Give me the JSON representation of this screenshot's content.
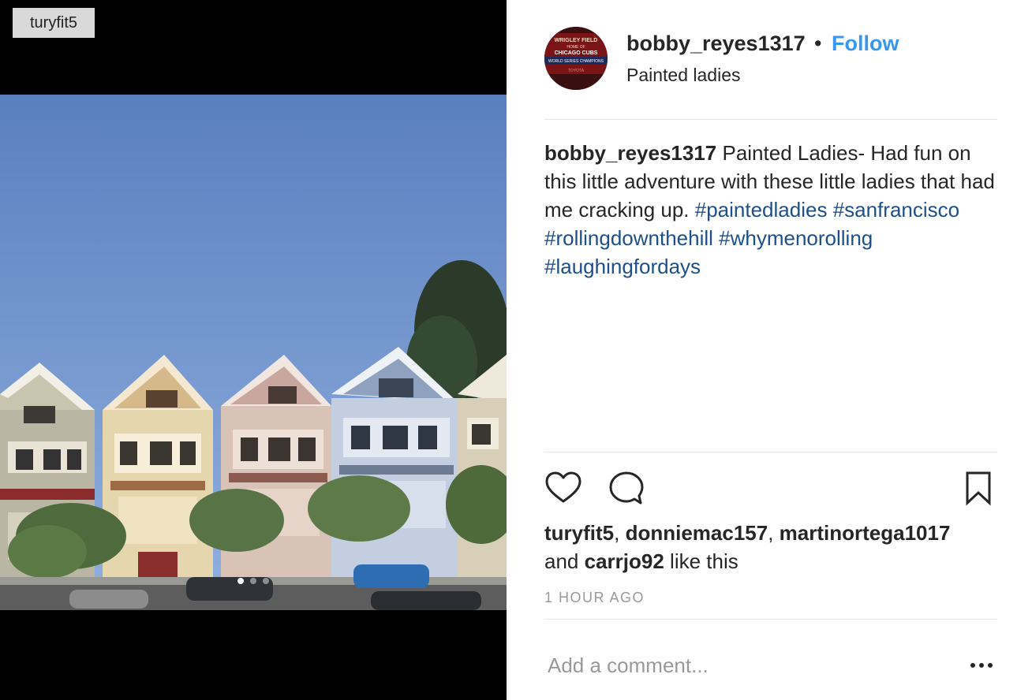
{
  "tag_label": "turyfit5",
  "photo": {
    "alt": "Painted Ladies houses on a hill under a blue sky",
    "slide_count": 3,
    "active_slide": 0
  },
  "header": {
    "username": "bobby_reyes1317",
    "separator": "•",
    "follow_label": "Follow",
    "location": "Painted ladies",
    "avatar": {
      "top_text": "WRIGLEY FIELD",
      "mid_text": "HOME OF",
      "brand_text": "CHICAGO CUBS",
      "bottom_text": "WORLD SERIES CHAMPIONS",
      "sponsor_text": "TOYOTA"
    }
  },
  "caption": {
    "username": "bobby_reyes1317",
    "text": " Painted Ladies- Had fun on this little adventure with these little ladies that had me cracking up. ",
    "hashtags": [
      "#paintedladies",
      "#sanfrancisco",
      "#rollingdownthehill",
      "#whymenorolling",
      "#laughingfordays"
    ]
  },
  "actions": {
    "like": "heart-icon",
    "comment": "comment-bubble-icon",
    "save": "bookmark-icon"
  },
  "likes": {
    "users": [
      "turyfit5",
      "donniemac157",
      "martinortega1017"
    ],
    "and_text": "and",
    "last_user": "carrjo92",
    "suffix": "like this"
  },
  "timestamp": "1 HOUR AGO",
  "comment": {
    "placeholder": "Add a comment..."
  },
  "colors": {
    "link": "#3897f0",
    "hashtag": "#1e4f8a",
    "muted": "#999999",
    "divider": "#e6e6e6"
  }
}
